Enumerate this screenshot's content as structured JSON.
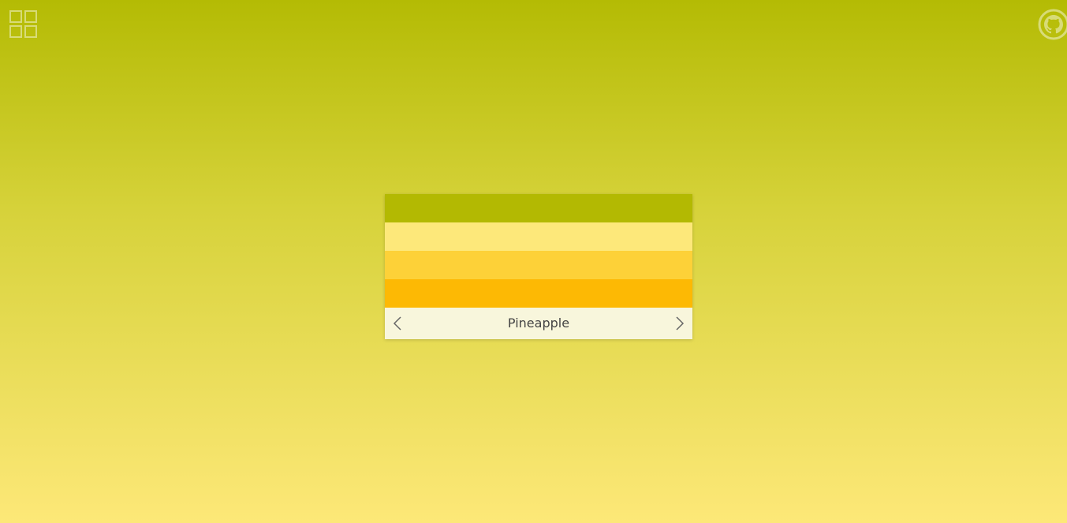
{
  "toolbar": {
    "grid_icon": "grid-icon",
    "github_icon": "github-icon"
  },
  "palette": {
    "name": "Pineapple",
    "colors": [
      "#b3b902",
      "#fde87a",
      "#fdd138",
      "#fdb904"
    ]
  },
  "nav": {
    "prev_icon": "chevron-left-icon",
    "next_icon": "chevron-right-icon"
  }
}
